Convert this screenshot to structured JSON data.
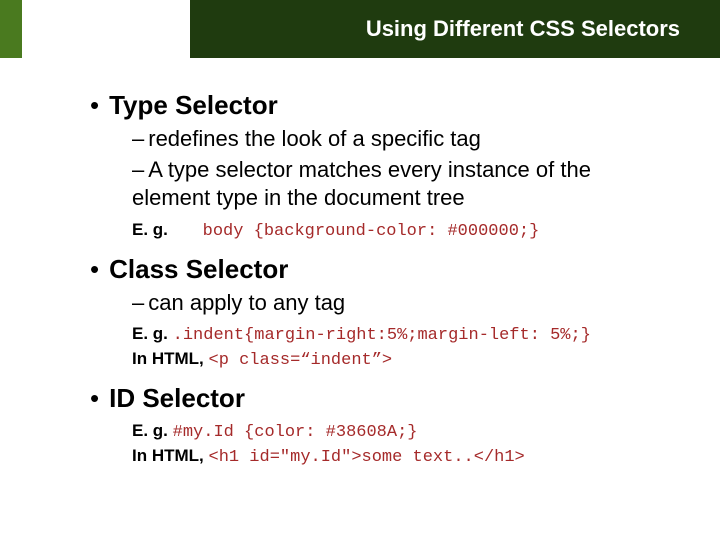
{
  "title": "Using Different CSS Selectors",
  "s1": {
    "heading": "Type Selector",
    "sub1": "redefines the look of a specific tag",
    "sub2": "A type selector matches every instance of the element type in the document tree",
    "eg_label": "E. g.",
    "eg_code": "body {background-color: #000000;}"
  },
  "s2": {
    "heading": "Class Selector",
    "sub1": "can apply to any tag",
    "eg_label": "E. g.",
    "eg_code": ".indent{margin-right:5%;margin-left: 5%;}",
    "html_label": "In HTML,",
    "html_code": "<p class=“indent”>"
  },
  "s3": {
    "heading": "ID Selector",
    "eg_label": "E. g.",
    "eg_code": "#my.Id {color: #38608A;}",
    "html_label": "In HTML,",
    "html_code": "<h1 id=\"my.Id\">some text..</h1>"
  },
  "glyph": {
    "bullet": "•",
    "dash": "–"
  }
}
